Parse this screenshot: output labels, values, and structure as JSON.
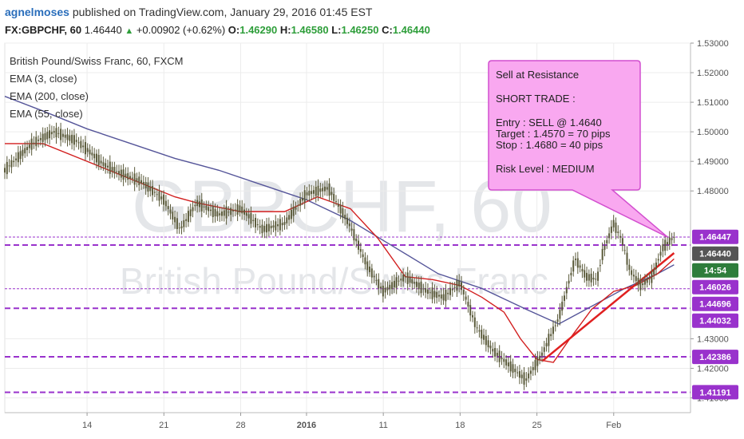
{
  "header": {
    "user": "agnelmoses",
    "published": "published on TradingView.com, January 29, 2016 01:45 EST",
    "symbol": "FX:GBPCHF, 60",
    "last": "1.46440",
    "change": "+0.00902 (+0.62%)",
    "o_label": "O:",
    "o_value": "1.46290",
    "h_label": "H:",
    "h_value": "1.46580",
    "l_label": "L:",
    "l_value": "1.46250",
    "c_label": "C:",
    "c_value": "1.46440"
  },
  "colors": {
    "candle": "#5a5a3a",
    "ema55": "#d21f1f",
    "ema200": "#555599",
    "level": "#9932cc",
    "trend": "#e02020",
    "annot_fill": "#f9a8f0",
    "annot_border": "#d24fcf"
  },
  "chart_data": {
    "type": "line",
    "legend": {
      "title": "British Pound/Swiss Franc, 60, FXCM",
      "items": [
        "EMA (3, close)",
        "EMA (200, close)",
        "EMA (55, close)"
      ]
    },
    "watermark": {
      "line1": "GBPCHF, 60",
      "line2": "British Pound/Swiss Franc"
    },
    "ylim": [
      1.405,
      1.53
    ],
    "y_ticks": [
      "1.53000",
      "1.52000",
      "1.51000",
      "1.50000",
      "1.49000",
      "1.48000",
      "1.43000",
      "1.42000",
      "1.41000"
    ],
    "x_ticks": [
      "14",
      "21",
      "28",
      "2016",
      "11",
      "18",
      "25",
      "Feb"
    ],
    "x_tick_days": [
      0,
      7,
      14,
      20,
      27,
      34,
      41,
      48
    ],
    "xlim_days": [
      -7.5,
      55
    ],
    "price_labels": [
      {
        "text": "1.46447",
        "value": 1.46447
      },
      {
        "text": "1.46440",
        "value": 1.4644
      },
      {
        "text": "14:54",
        "value": 1.462
      },
      {
        "text": "1.46026",
        "value": 1.46026
      },
      {
        "text": "1.44696",
        "value": 1.44696
      },
      {
        "text": "1.44032",
        "value": 1.44032
      },
      {
        "text": "1.42386",
        "value": 1.42386
      },
      {
        "text": "1.41191",
        "value": 1.41191
      }
    ],
    "levels": [
      1.4644,
      1.4617,
      1.4469,
      1.4403,
      1.4239,
      1.4119
    ],
    "trendline": {
      "from": [
        41.5,
        1.4225
      ],
      "to": [
        53.5,
        1.459
      ]
    },
    "price_series": {
      "days": [
        -7.5,
        -5,
        -3,
        -1,
        0,
        1.5,
        3,
        5,
        7,
        8.5,
        10,
        12,
        14,
        16,
        18,
        20,
        22,
        24,
        25.5,
        27,
        29,
        31,
        32.5,
        34,
        35.5,
        37,
        38.5,
        40,
        41.5,
        43,
        44.5,
        45.5,
        46.5,
        47,
        48,
        48.8,
        49.5,
        50.5,
        51.5,
        52.5,
        53.5
      ],
      "values": [
        1.487,
        1.496,
        1.5,
        1.497,
        1.494,
        1.489,
        1.486,
        1.483,
        1.477,
        1.467,
        1.476,
        1.472,
        1.474,
        1.467,
        1.469,
        1.479,
        1.481,
        1.468,
        1.455,
        1.446,
        1.451,
        1.446,
        1.444,
        1.449,
        1.434,
        1.426,
        1.421,
        1.416,
        1.425,
        1.437,
        1.457,
        1.451,
        1.45,
        1.459,
        1.469,
        1.463,
        1.453,
        1.448,
        1.451,
        1.461,
        1.4644
      ]
    },
    "ema55": {
      "days": [
        -7.5,
        -4,
        0,
        4,
        8,
        10,
        14,
        18,
        21,
        24,
        26.5,
        29,
        31.5,
        34,
        36,
        38,
        39.5,
        41,
        42.5,
        44,
        46,
        48,
        50,
        52,
        53.5
      ],
      "values": [
        1.496,
        1.496,
        1.49,
        1.484,
        1.478,
        1.476,
        1.473,
        1.473,
        1.478,
        1.474,
        1.464,
        1.451,
        1.45,
        1.448,
        1.444,
        1.439,
        1.43,
        1.423,
        1.422,
        1.43,
        1.44,
        1.446,
        1.448,
        1.452,
        1.457
      ]
    },
    "ema200": {
      "days": [
        -7.5,
        -4,
        0,
        4,
        8,
        12,
        16,
        20,
        24,
        28,
        32,
        36,
        40,
        43,
        46,
        49,
        52,
        53.5
      ],
      "values": [
        1.512,
        1.507,
        1.501,
        1.496,
        1.491,
        1.487,
        1.482,
        1.477,
        1.47,
        1.461,
        1.452,
        1.447,
        1.44,
        1.435,
        1.441,
        1.447,
        1.452,
        1.455
      ]
    },
    "annotation": {
      "lines": [
        "Sell at Resistance",
        "",
        "SHORT TRADE :",
        "",
        "Entry     :   SELL @ 1.4640",
        "Target  :   1.4570  = 70 pips",
        "Stop     :   1.4680  =  40 pips",
        "",
        "Risk Level : MEDIUM"
      ],
      "anchor": [
        52.9,
        1.4644
      ]
    }
  }
}
